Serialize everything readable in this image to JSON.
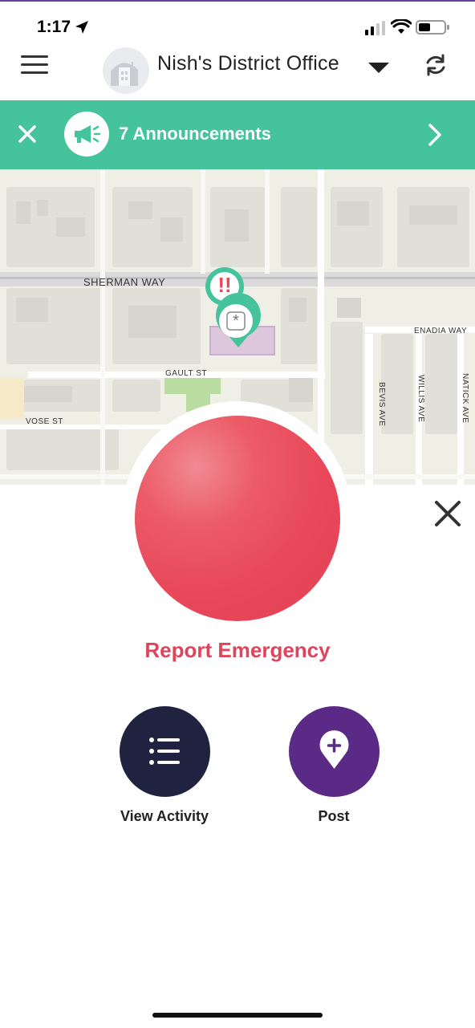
{
  "status_bar": {
    "time": "1:17"
  },
  "header": {
    "office_name": "Nish's District Office"
  },
  "announcements": {
    "label": "7 Announcements"
  },
  "map": {
    "streets": [
      "SHERMAN WAY",
      "GAULT ST",
      "VOSE ST",
      "ENADIA WAY",
      "BEVIS AVE",
      "WILLIS AVE",
      "NATICK AVE"
    ],
    "marker_alert": "!!",
    "marker_asterisk": "*"
  },
  "emergency": {
    "label": "Report Emergency"
  },
  "actions": [
    {
      "label": "View Activity",
      "icon": "list-icon"
    },
    {
      "label": "Post",
      "icon": "add-location-icon"
    }
  ],
  "colors": {
    "accent_green": "#45c39b",
    "emergency_red": "#e8485a",
    "navy": "#1f2340",
    "purple": "#5b2a86"
  }
}
